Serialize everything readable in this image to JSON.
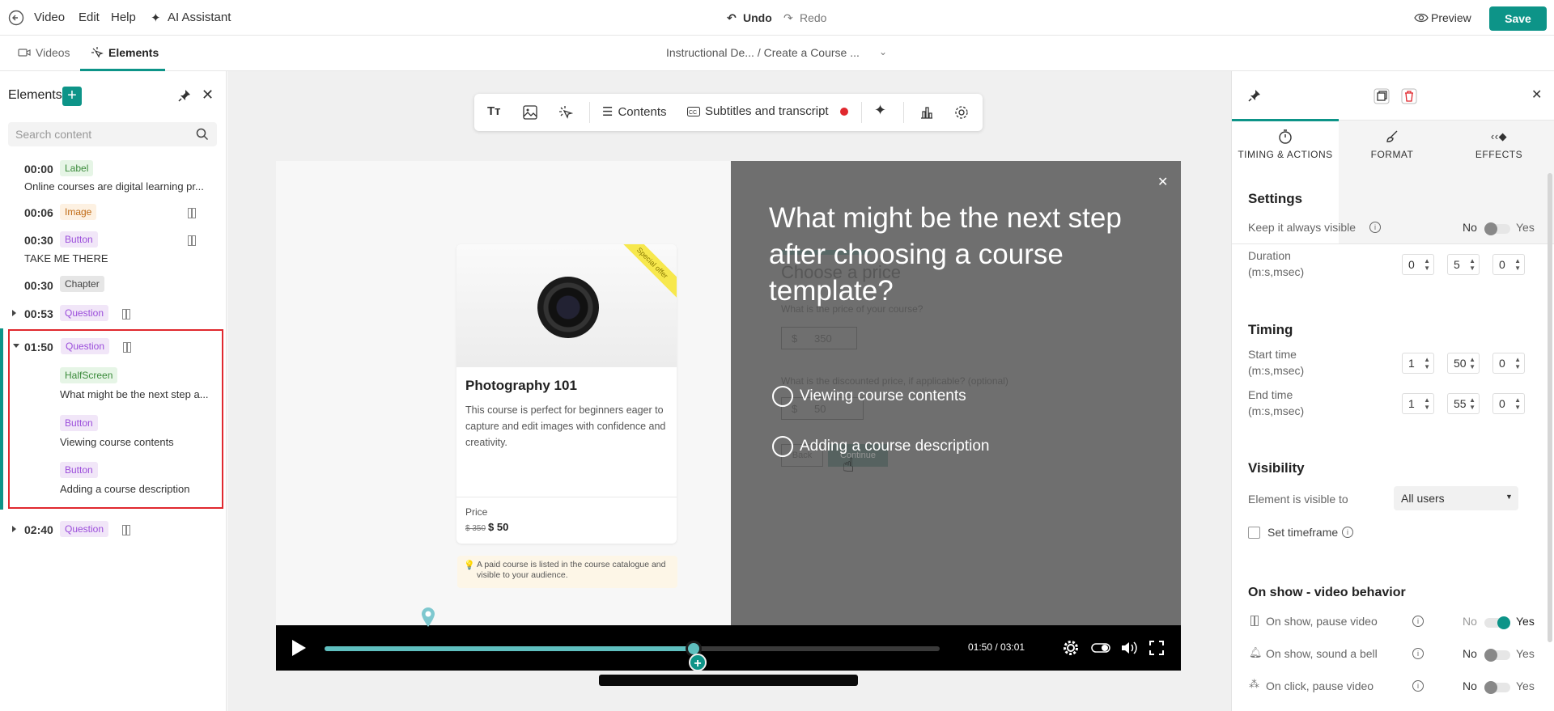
{
  "topbar": {
    "menu": [
      "Video",
      "Edit",
      "Help"
    ],
    "ai_assistant": "AI Assistant",
    "undo": "Undo",
    "redo": "Redo",
    "preview": "Preview",
    "save": "Save"
  },
  "tabs": {
    "videos": "Videos",
    "elements": "Elements",
    "breadcrumb": "Instructional De...  / Create a Course ..."
  },
  "left": {
    "title": "Elements",
    "search_placeholder": "Search content",
    "rows": [
      {
        "time": "00:00",
        "type": "Label",
        "text": "Online courses are digital learning pr..."
      },
      {
        "time": "00:06",
        "type": "Image"
      },
      {
        "time": "00:30",
        "type": "Button",
        "text": "TAKE ME THERE"
      },
      {
        "time": "00:30",
        "type": "Chapter"
      },
      {
        "time": "00:53",
        "type": "Question"
      },
      {
        "time": "01:50",
        "type": "Question",
        "children": [
          {
            "type": "HalfScreen",
            "text": "What might be the next step a..."
          },
          {
            "type": "Button",
            "text": "Viewing course contents"
          },
          {
            "type": "Button",
            "text": "Adding a course description"
          }
        ]
      },
      {
        "time": "02:40",
        "type": "Question"
      }
    ]
  },
  "toolbar": {
    "contents": "Contents",
    "subtitles": "Subtitles and transcript"
  },
  "video": {
    "card_title": "Photography 101",
    "card_desc": "This course is perfect for beginners eager to capture and edit images with confidence and creativity.",
    "ribbon": "Special offer",
    "price_label": "Price",
    "price_old": "$ 350",
    "price_new": "$ 50",
    "note": "A paid course is listed in the course catalogue and visible to your audience.",
    "ghost_title": "Choose a price",
    "ghost_q1": "What is the price of your course?",
    "ghost_currency": "$",
    "ghost_price": "350",
    "ghost_q2": "What is the discounted price, if applicable? (optional)",
    "ghost_discount": "50",
    "ghost_back": "Back",
    "ghost_continue": "Continue",
    "question": "What might be the next step after choosing a course template?",
    "options": [
      "Viewing course contents",
      "Adding a course description"
    ],
    "timecode": "01:50 / 03:01",
    "progress": 0.6
  },
  "right": {
    "tabs": [
      "TIMING & ACTIONS",
      "FORMAT",
      "EFFECTS"
    ],
    "settings_title": "Settings",
    "keep_visible": "Keep it always visible",
    "no": "No",
    "yes": "Yes",
    "duration_label": "Duration\n(m:s,msec)",
    "duration": [
      "0",
      "5",
      "0"
    ],
    "timing_title": "Timing",
    "start_label": "Start time\n(m:s,msec)",
    "start": [
      "1",
      "50",
      "0"
    ],
    "end_label": "End time\n(m:s,msec)",
    "end": [
      "1",
      "55",
      "0"
    ],
    "visibility_title": "Visibility",
    "visible_to_label": "Element is visible to",
    "visible_to": "All users",
    "set_timeframe": "Set timeframe",
    "onshow_title": "On show - video behavior",
    "pause_video": "On show, pause video",
    "sound_bell": "On show, sound a bell",
    "click_pause": "On click, pause video"
  }
}
